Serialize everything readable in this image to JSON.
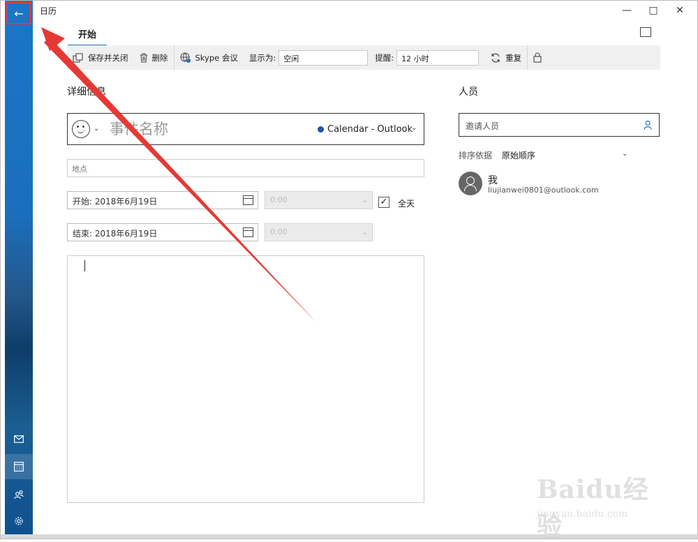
{
  "window": {
    "title": "日历"
  },
  "tabs": [
    {
      "label": "开始"
    }
  ],
  "toolbar": {
    "save_close": "保存并关闭",
    "delete": "删除",
    "skype": "Skype 会议",
    "show_as_label": "显示为:",
    "show_as_value": "空闲",
    "reminder_label": "提醒:",
    "reminder_value": "12 小时",
    "repeat": "重复"
  },
  "details": {
    "title": "详细信息",
    "event_name_placeholder": "事件名称",
    "calendar": "Calendar - Outlook",
    "location_placeholder": "地点",
    "start_label": "开始:",
    "start_date": "2018年6月19日",
    "start_time": "0:00",
    "end_label": "结束:",
    "end_date": "2018年6月19日",
    "end_time": "0:00",
    "all_day": "全天",
    "all_day_checked": true
  },
  "people": {
    "title": "人员",
    "invite_placeholder": "邀请人员",
    "sort_label": "排序依据",
    "sort_value": "原始顺序",
    "attendees": [
      {
        "name": "我",
        "email": "liujianwei0801@outlook.com"
      }
    ]
  },
  "watermark": {
    "main": "Baidu经验",
    "sub": "jingyan.baidu.com"
  },
  "colors": {
    "accent": "#1a73c9",
    "annotation": "#e53935",
    "calendar": "#1f56a5"
  },
  "icons": [
    "back-arrow-icon",
    "mail-icon",
    "calendar-icon",
    "people-icon",
    "settings-icon",
    "save-close-icon",
    "trash-icon",
    "skype-icon",
    "repeat-icon",
    "lock-icon",
    "emoji-icon",
    "calendar-picker-icon",
    "person-add-icon",
    "popout-icon"
  ]
}
